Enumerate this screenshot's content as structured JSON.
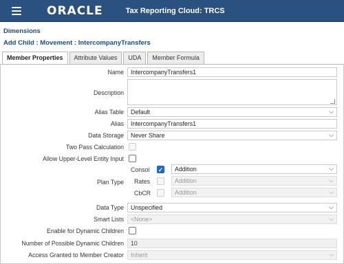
{
  "header": {
    "app_name": "Tax Reporting Cloud: TRCS",
    "logo_text": "ORACLE",
    "bg_color": "#2a5180"
  },
  "breadcrumb": "Dimensions",
  "page_title": "Add Child : Movement : IntercompanyTransfers",
  "tabs": [
    {
      "label": "Member Properties",
      "active": true
    },
    {
      "label": "Attribute Values",
      "active": false
    },
    {
      "label": "UDA",
      "active": false
    },
    {
      "label": "Member Formula",
      "active": false
    }
  ],
  "form": {
    "name": {
      "label": "Name",
      "value": "IntercompanyTransfers1"
    },
    "description": {
      "label": "Description",
      "value": ""
    },
    "alias_table": {
      "label": "Alias Table",
      "value": "Default"
    },
    "alias": {
      "label": "Alias",
      "value": "IntercompanyTransfers1"
    },
    "data_storage": {
      "label": "Data Storage",
      "value": "Never Share"
    },
    "two_pass": {
      "label": "Two Pass Calculation",
      "checked": false,
      "disabled": true
    },
    "allow_upper": {
      "label": "Allow Upper-Level Entity Input",
      "checked": false
    },
    "plan_type": {
      "label": "Plan Type",
      "rows": [
        {
          "name": "Consol",
          "checked": true,
          "disabled": false,
          "aggregation": "Addition"
        },
        {
          "name": "Rates",
          "checked": false,
          "disabled": true,
          "aggregation": "Addition"
        },
        {
          "name": "CbCR",
          "checked": false,
          "disabled": true,
          "aggregation": "Addition"
        }
      ]
    },
    "data_type": {
      "label": "Data Type",
      "value": "Unspecified"
    },
    "smart_lists": {
      "label": "Smart Lists",
      "value": "<None>"
    },
    "enable_dynamic": {
      "label": "Enable for Dynamic Children",
      "checked": false
    },
    "num_dynamic": {
      "label": "Number of Possible Dynamic Children",
      "value": "10"
    },
    "access_granted": {
      "label": "Access Granted to Member Creator",
      "value": "Inherit"
    }
  }
}
